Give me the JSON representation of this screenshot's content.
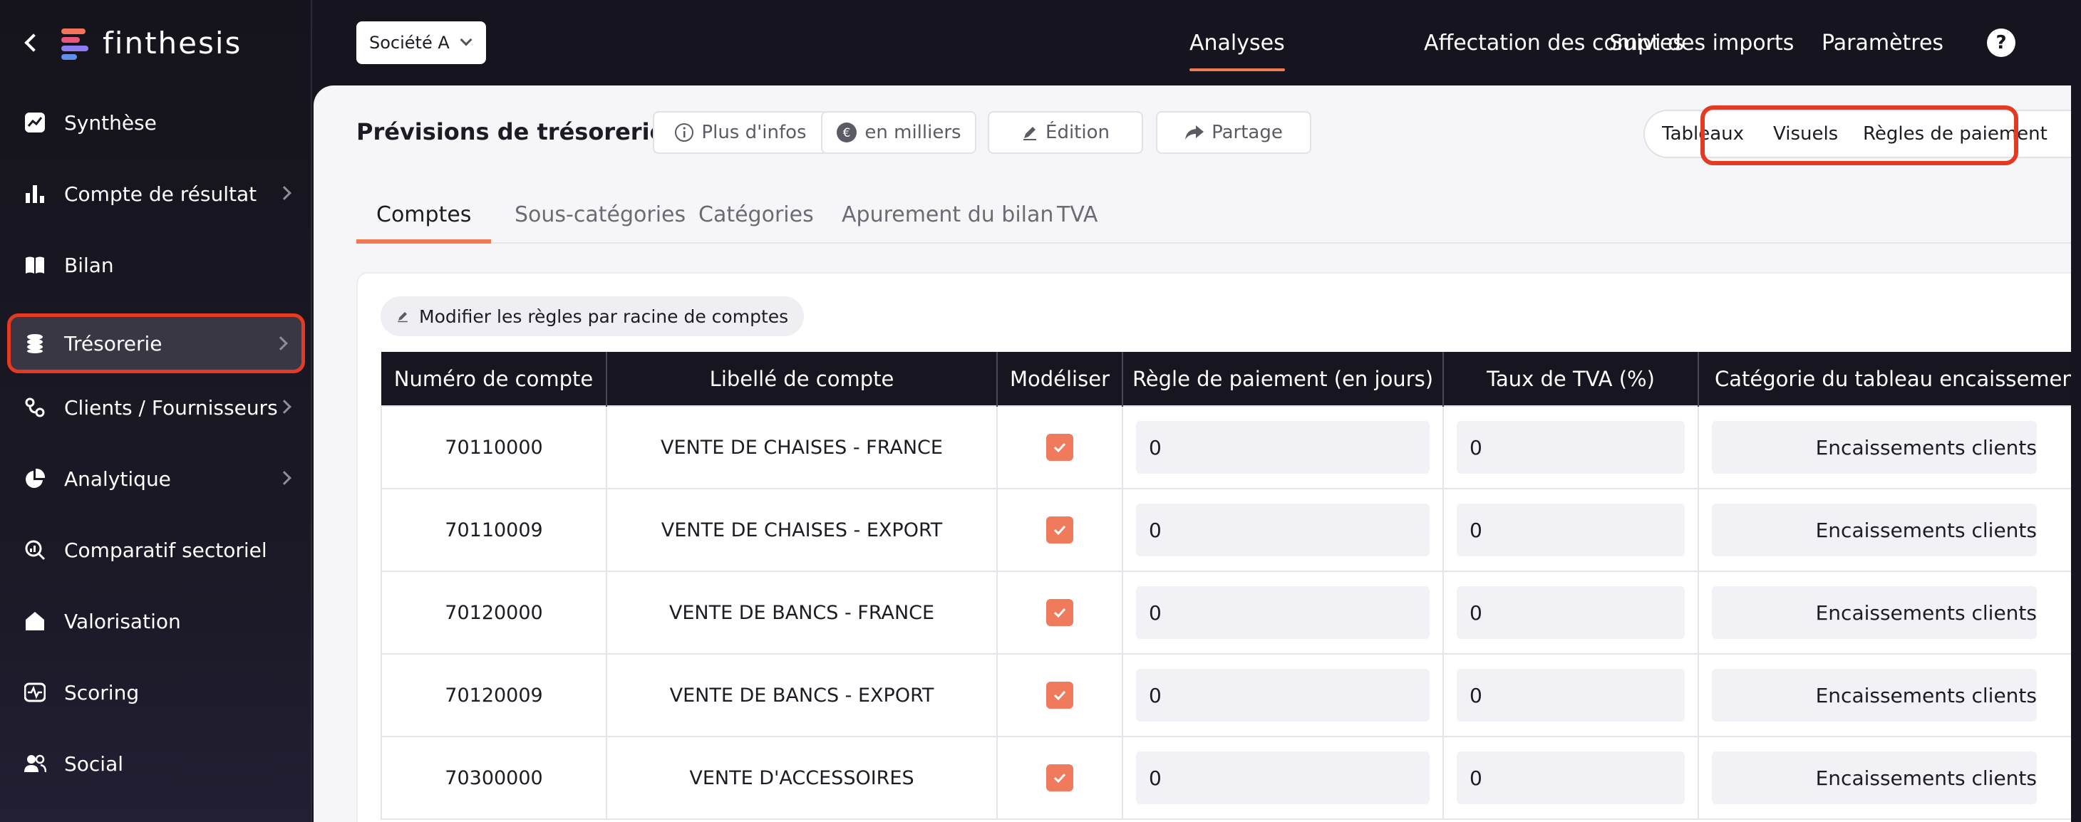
{
  "brand": {
    "name": "finthesis"
  },
  "sidebar": {
    "items": [
      {
        "label": "Synthèse",
        "icon": "line-chart-icon",
        "chevron": false
      },
      {
        "label": "Compte de résultat",
        "icon": "bar-chart-icon",
        "chevron": true
      },
      {
        "label": "Bilan",
        "icon": "book-icon",
        "chevron": false
      },
      {
        "label": "Trésorerie",
        "icon": "coins-icon",
        "chevron": true,
        "active": true
      },
      {
        "label": "Clients / Fournisseurs",
        "icon": "link-icon",
        "chevron": true
      },
      {
        "label": "Analytique",
        "icon": "pie-chart-icon",
        "chevron": true
      },
      {
        "label": "Comparatif sectoriel",
        "icon": "analysis-search-icon",
        "chevron": false
      },
      {
        "label": "Valorisation",
        "icon": "home-icon",
        "chevron": false
      },
      {
        "label": "Scoring",
        "icon": "pulse-icon",
        "chevron": false
      },
      {
        "label": "Social",
        "icon": "users-icon",
        "chevron": false
      }
    ]
  },
  "topbar": {
    "company": "Société A",
    "nav": [
      "Analyses",
      "Affectation des comptes",
      "Suivi des imports",
      "Paramètres"
    ],
    "active_nav": "Analyses",
    "help": "?"
  },
  "page": {
    "title": "Prévisions de trésorerie",
    "buttons": {
      "info": "Plus d'infos",
      "units": "en milliers",
      "edit": "Édition",
      "share": "Partage"
    },
    "views": [
      "Tableaux",
      "Visuels",
      "Règles de paiement"
    ],
    "active_view": "Règles de paiement",
    "tabs": [
      "Comptes",
      "Sous-catégories",
      "Catégories",
      "Apurement du bilan",
      "TVA"
    ],
    "active_tab": "Comptes",
    "modify_rules": "Modifier les règles par racine de comptes"
  },
  "table": {
    "headers": [
      "Numéro de compte",
      "Libellé de compte",
      "Modéliser",
      "Règle de paiement (en jours)",
      "Taux de TVA (%)",
      "Catégorie du tableau encaissement"
    ],
    "rows": [
      {
        "account": "70110000",
        "label": "VENTE DE CHAISES - FRANCE",
        "model": true,
        "payment_rule": "0",
        "vat": "0",
        "category": "Encaissements clients"
      },
      {
        "account": "70110009",
        "label": "VENTE DE CHAISES - EXPORT",
        "model": true,
        "payment_rule": "0",
        "vat": "0",
        "category": "Encaissements clients"
      },
      {
        "account": "70120000",
        "label": "VENTE DE BANCS - FRANCE",
        "model": true,
        "payment_rule": "0",
        "vat": "0",
        "category": "Encaissements clients"
      },
      {
        "account": "70120009",
        "label": "VENTE DE BANCS - EXPORT",
        "model": true,
        "payment_rule": "0",
        "vat": "0",
        "category": "Encaissements clients"
      },
      {
        "account": "70300000",
        "label": "VENTE D'ACCESSOIRES",
        "model": true,
        "payment_rule": "0",
        "vat": "0",
        "category": "Encaissements clients"
      }
    ]
  },
  "colors": {
    "accent": "#f07a52",
    "highlight": "#e43a24",
    "dark": "#16141f"
  }
}
